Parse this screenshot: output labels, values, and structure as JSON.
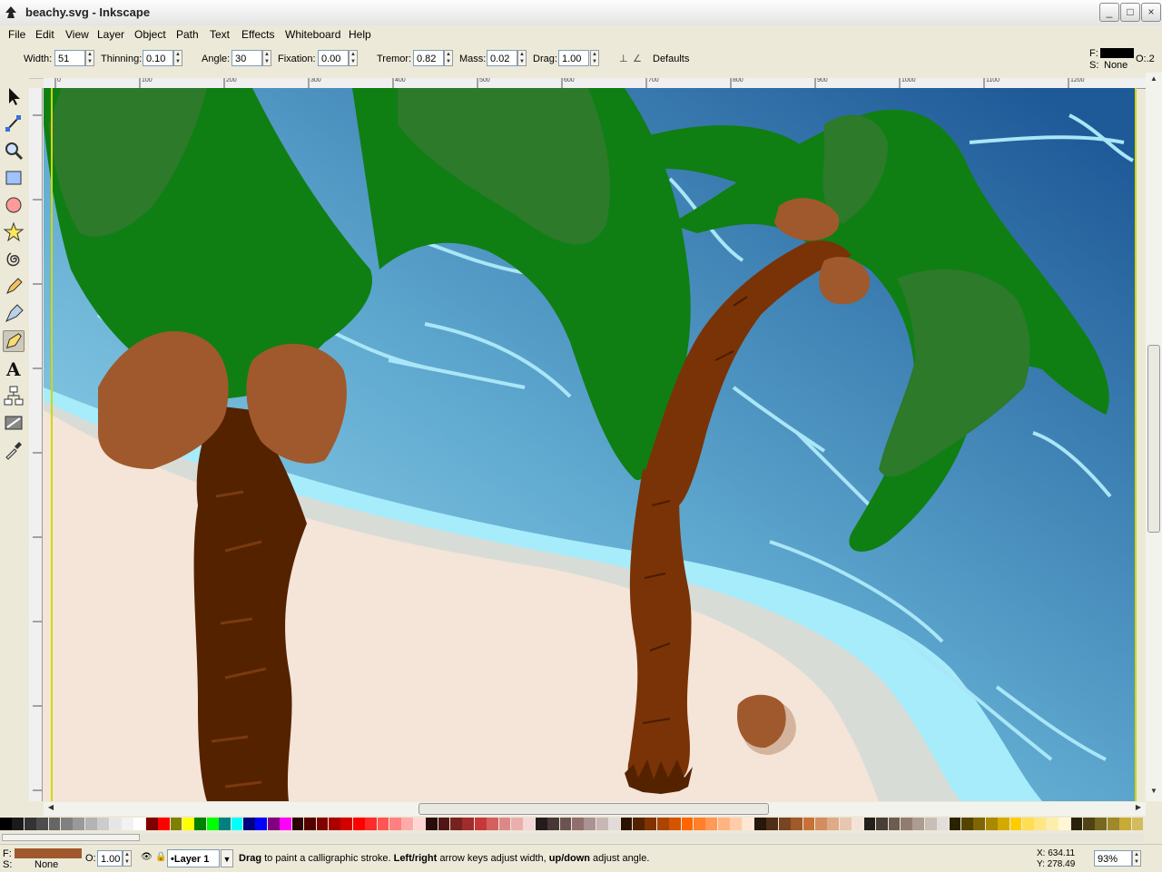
{
  "window": {
    "title": "beachy.svg - Inkscape",
    "minimize": "_",
    "maximize": "□",
    "close": "×"
  },
  "menu": [
    "File",
    "Edit",
    "View",
    "Layer",
    "Object",
    "Path",
    "Text",
    "Effects",
    "Whiteboard",
    "Help"
  ],
  "controls": {
    "width_label": "Width:",
    "width_value": "51",
    "thinning_label": "Thinning:",
    "thinning_value": "0.10",
    "angle_label": "Angle:",
    "angle_value": "30",
    "fixation_label": "Fixation:",
    "fixation_value": "0.00",
    "tremor_label": "Tremor:",
    "tremor_value": "0.82",
    "mass_label": "Mass:",
    "mass_value": "0.02",
    "drag_label": "Drag:",
    "drag_value": "1.00",
    "defaults_label": "Defaults"
  },
  "style_indicator": {
    "fill_label": "F:",
    "stroke_label": "S:",
    "stroke_value": "None",
    "opacity_label": "O:.2",
    "fill_color": "#000000"
  },
  "ruler_top": [
    "0",
    "100",
    "200",
    "300",
    "400",
    "500",
    "600",
    "700",
    "800",
    "900",
    "1000",
    "1100",
    "1200"
  ],
  "tools": [
    "selector-tool",
    "node-tool",
    "zoom-tool",
    "rectangle-tool",
    "ellipse-tool",
    "star-tool",
    "spiral-tool",
    "pencil-tool",
    "pen-tool",
    "calligraphy-tool",
    "text-tool",
    "connector-tool",
    "gradient-tool",
    "dropper-tool"
  ],
  "palette": [
    "#000000",
    "#1a1a1a",
    "#333333",
    "#4d4d4d",
    "#666666",
    "#808080",
    "#999999",
    "#b3b3b3",
    "#cccccc",
    "#e6e6e6",
    "#f2f2f2",
    "#ffffff",
    "#800000",
    "#ff0000",
    "#808000",
    "#ffff00",
    "#008000",
    "#00ff00",
    "#008080",
    "#00ffff",
    "#000080",
    "#0000ff",
    "#800080",
    "#ff00ff",
    "#2b0000",
    "#550000",
    "#800000",
    "#aa0000",
    "#d40000",
    "#ff0000",
    "#ff2a2a",
    "#ff5555",
    "#ff8080",
    "#ffaaaa",
    "#ffd5d5",
    "#280b0b",
    "#501616",
    "#782121",
    "#a02c2c",
    "#c83737",
    "#d35f5f",
    "#de8787",
    "#e9afaf",
    "#f4d7d7",
    "#241c1c",
    "#483737",
    "#6c5353",
    "#916f6f",
    "#ac9393",
    "#c8b7b7",
    "#e3dbdb",
    "#2b1100",
    "#552200",
    "#803300",
    "#aa4400",
    "#d45500",
    "#ff6600",
    "#ff7f2a",
    "#ff9955",
    "#ffb380",
    "#ffccaa",
    "#ffe6d5",
    "#28170b",
    "#502d16",
    "#784421",
    "#a05a2c",
    "#c87137",
    "#d38d5f",
    "#deaa87",
    "#e9c6af",
    "#f4e3d7",
    "#241f1c",
    "#483e37",
    "#6c5d53",
    "#917c6f",
    "#ac9d93",
    "#c8beb7",
    "#e3dedb",
    "#2b2200",
    "#554400",
    "#806600",
    "#aa8800",
    "#d4aa00",
    "#ffcc00",
    "#ffdd55",
    "#ffe680",
    "#ffeeaa",
    "#fff6d5",
    "#28220b",
    "#504416",
    "#786721",
    "#a0892c",
    "#c8ab37",
    "#d3bc5f"
  ],
  "status": {
    "fill_label": "F:",
    "stroke_label": "S:",
    "stroke_value": "None",
    "fill_color": "#a0592c",
    "opacity_label": "O:",
    "opacity_value": "1.00",
    "layer": "•Layer 1",
    "msg_drag": "Drag",
    "msg_part1": " to paint a calligraphic stroke. ",
    "msg_leftright": "Left/right",
    "msg_part2": " arrow keys adjust width, ",
    "msg_updown": "up/down",
    "msg_part3": " adjust angle.",
    "x_coord": "X: 634.11",
    "y_coord": "Y: 278.49",
    "zoom": "93%"
  }
}
